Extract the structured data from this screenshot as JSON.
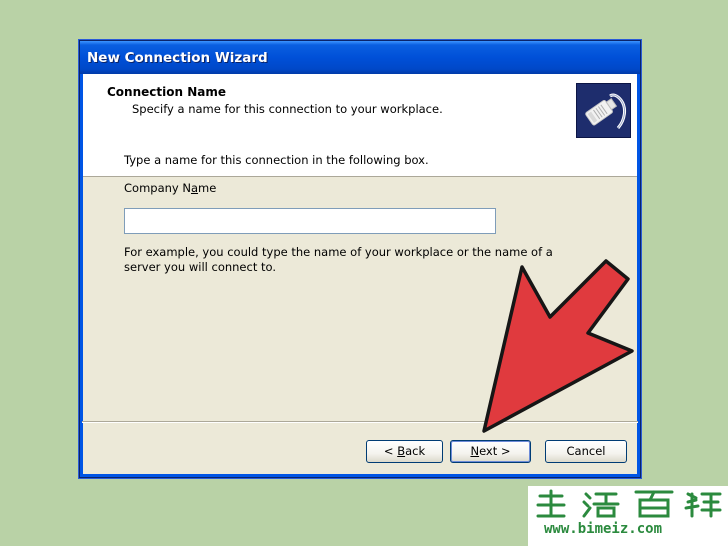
{
  "window": {
    "title": "New Connection Wizard"
  },
  "header": {
    "title": "Connection Name",
    "subtitle": "Specify a name for this connection to your workplace.",
    "icon": "network-plug-icon"
  },
  "content": {
    "prompt": "Type a name for this connection in the following box.",
    "field_label_before": "Company N",
    "field_label_mnemonic": "a",
    "field_label_after": "me",
    "company_name_value": "",
    "example": "For example, you could type the name of your workplace or the name of a server you will connect to."
  },
  "buttons": {
    "back_prefix": "< ",
    "back_mnemonic": "B",
    "back_rest": "ack",
    "next_mnemonic": "N",
    "next_rest": "ext >",
    "cancel": "Cancel"
  },
  "overlay": {
    "arrow_color": "#e03a3e",
    "arrow_icon": "red-pointer-arrow-icon"
  },
  "watermark": {
    "url": "www.bimeiz.com",
    "color": "#2b8a3e"
  },
  "colors": {
    "desktop": "#b9d2a6",
    "titlebar": "#0050d8",
    "dialog_face": "#ece9d8"
  }
}
